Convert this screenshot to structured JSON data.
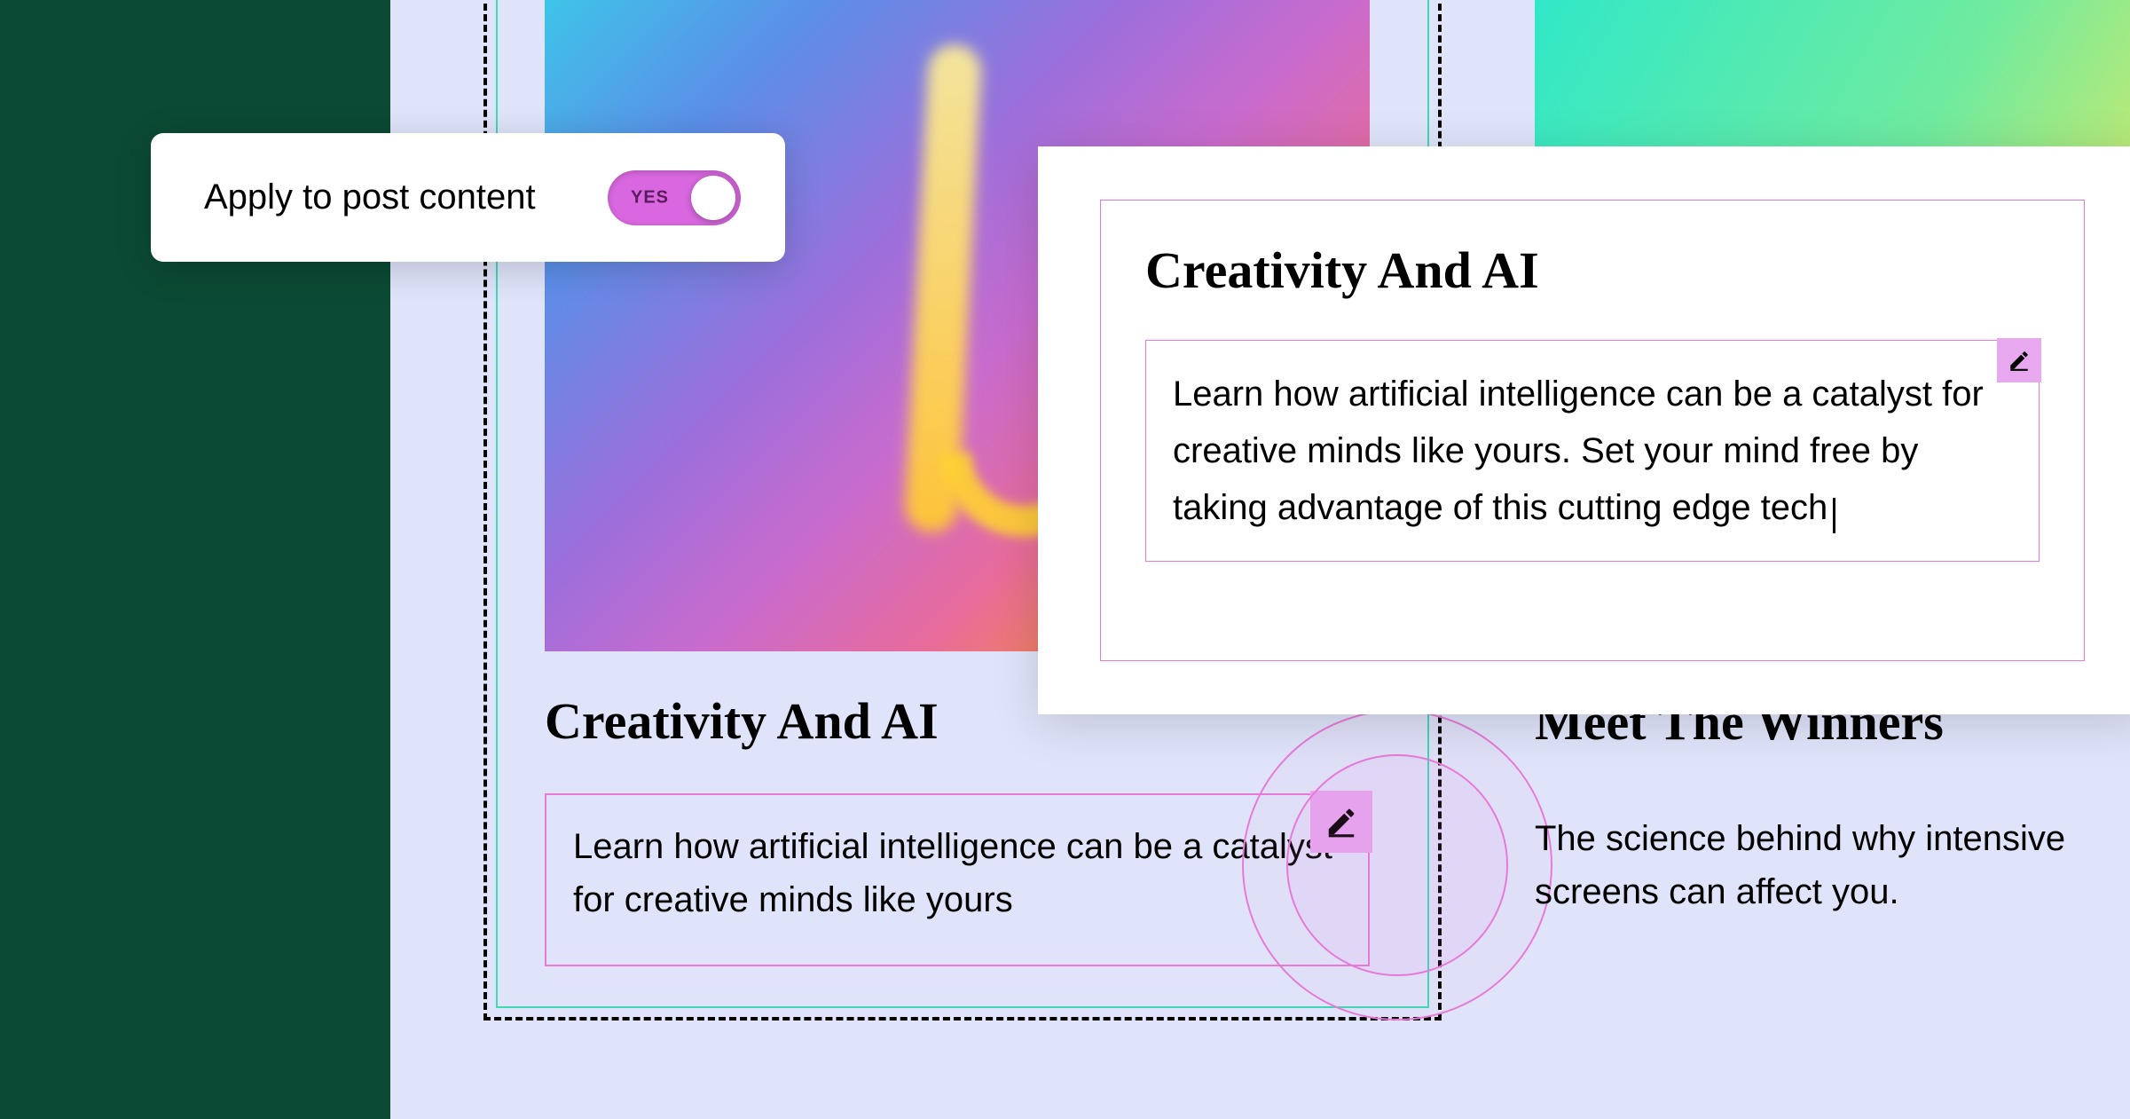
{
  "toggle": {
    "label": "Apply to post content",
    "state_label": "YES"
  },
  "cards": {
    "left": {
      "title": "Creativity And AI",
      "description": "Learn how artificial intelligence can be a catalyst for creative minds like yours"
    },
    "right": {
      "title": "Meet The Winners",
      "description": "The science behind why intensive screens can affect you."
    }
  },
  "editor": {
    "title": "Creativity And AI",
    "text": "Learn how artificial intelligence can be a catalyst for creative minds like yours. Set your mind free by taking advantage of this cutting edge tech"
  },
  "colors": {
    "accent_green": "#0B4A34",
    "accent_magenta": "#E879D8",
    "accent_teal": "#3DD9B3",
    "edit_badge": "#E8A8F0",
    "toggle_on": "#D968E0",
    "canvas_bg": "#DFE4FA"
  }
}
